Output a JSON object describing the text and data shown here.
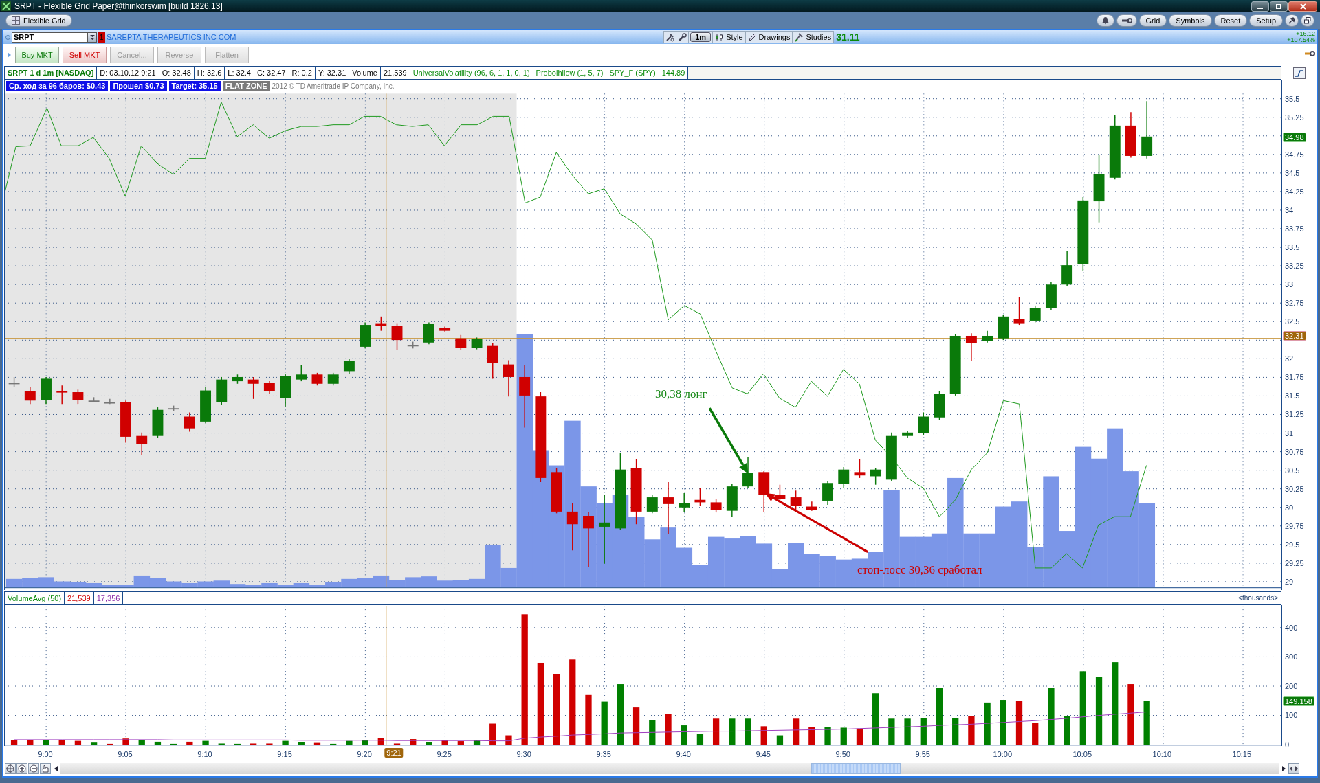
{
  "window": {
    "title": "SRPT - Flexible Grid Paper@thinkorswim [build 1826.13]"
  },
  "grid_bar": {
    "tab": "Flexible Grid",
    "buttons": [
      "Grid",
      "Symbols",
      "Reset",
      "Setup"
    ]
  },
  "symbol_bar": {
    "symbol": "SRPT",
    "link": "1",
    "company": "SAREPTA THERAPEUTICS INC COM",
    "aggregation": "1m",
    "tools": [
      "Style",
      "Drawings",
      "Studies"
    ],
    "last": "31.11",
    "change": "+16.12",
    "change_percent": "+107.54%"
  },
  "order_buttons": [
    {
      "label": "Buy MKT",
      "kind": "buy",
      "disabled": false
    },
    {
      "label": "Sell MKT",
      "kind": "sell",
      "disabled": false
    },
    {
      "label": "Cancel...",
      "disabled": true
    },
    {
      "label": "Reverse",
      "disabled": true
    },
    {
      "label": "Flatten",
      "disabled": true
    }
  ],
  "info_strip": [
    {
      "text": "SRPT 1 d 1m [NASDAQ]",
      "kind": "title"
    },
    {
      "text": "D: 03.10.12 9:21",
      "kind": "plain"
    },
    {
      "text": "O: 32.48",
      "kind": "plain"
    },
    {
      "text": "H: 32.6",
      "kind": "plain"
    },
    {
      "text": "L: 32.4",
      "kind": "plain"
    },
    {
      "text": "C: 32.47",
      "kind": "plain"
    },
    {
      "text": "R: 0.2",
      "kind": "plain"
    },
    {
      "text": "Y: 32.31",
      "kind": "plain"
    },
    {
      "text": "Volume",
      "kind": "plain"
    },
    {
      "text": "21,539",
      "kind": "plain"
    },
    {
      "text": "UniversalVolatility (96, 6, 1, 1, 0, 1)",
      "kind": "study"
    },
    {
      "text": "Proboihilow (1, 5, 7)",
      "kind": "study"
    },
    {
      "text": "SPY_F (SPY)",
      "kind": "study"
    },
    {
      "text": "144.89",
      "kind": "study"
    }
  ],
  "badges": [
    {
      "text": "Ср. ход за 96 баров: $0.43",
      "kind": "info"
    },
    {
      "text": "Прошел $0.73",
      "kind": "info"
    },
    {
      "text": "Target: 35.15",
      "kind": "info"
    },
    {
      "text": "FLAT ZONE",
      "kind": "zone"
    }
  ],
  "copyright": "2012 © TD Ameritrade IP Company, Inc.",
  "annotations": [
    {
      "text": "30,38 лонг",
      "kind": "long"
    },
    {
      "text": "стоп-лосс 30,36 сработал",
      "kind": "stop"
    }
  ],
  "price_axis": {
    "labels": [
      "35.5",
      "35.25",
      "34.75",
      "34.5",
      "34.25",
      "34",
      "33.75",
      "33.5",
      "33.25",
      "33",
      "32.75",
      "32.5",
      "32",
      "31.75",
      "31.5",
      "31.25",
      "31",
      "30.75",
      "30.5",
      "30.25",
      "30",
      "29.75",
      "29.5",
      "29.25",
      "29"
    ],
    "markers": [
      {
        "text": "34.98",
        "kind": "last"
      },
      {
        "text": "32.31",
        "kind": "cursor"
      }
    ]
  },
  "volume_header": {
    "volume": "21,539",
    "average": "17,356",
    "units": "<thousands>"
  },
  "volume_pane": {
    "marker": "149.158",
    "chart_data": {
      "type": "bar",
      "stacked": true,
      "grid": true,
      "categories": [
        null,
        null,
        "9:00",
        null,
        null,
        null,
        null,
        "9:05",
        null,
        null,
        null,
        null,
        "9:10",
        null,
        null,
        null,
        null,
        "9:15",
        null,
        null,
        null,
        null,
        "9:20",
        null,
        null,
        null,
        null,
        "9:25",
        null,
        null,
        null,
        null,
        "9:30",
        null,
        null,
        null,
        null,
        "9:35",
        null,
        null,
        null,
        null,
        "9:40",
        null,
        null,
        null,
        null,
        "9:45",
        null,
        null,
        null,
        null,
        "9:50",
        null,
        null,
        null,
        null,
        "9:55",
        null,
        null,
        null,
        null,
        "10:00",
        null,
        null,
        null,
        null,
        "10:05",
        null,
        null,
        null,
        null,
        "10:10",
        null,
        null,
        null,
        null,
        "10:15"
      ],
      "series": [
        {
          "color": "#008000",
          "values": [
            null,
            null,
            16,
            null,
            null,
            7,
            null,
            null,
            15,
            10,
            3,
            null,
            13,
            4,
            3,
            null,
            null,
            13,
            9,
            null,
            3,
            13,
            16,
            null,
            null,
            null,
            9,
            null,
            null,
            15,
            null,
            null,
            null,
            null,
            null,
            null,
            null,
            147,
            207,
            null,
            84,
            null,
            66,
            37,
            null,
            89,
            89,
            null,
            32,
            null,
            null,
            60,
            58,
            null,
            176,
            89,
            89,
            92,
            193,
            92,
            null,
            144,
            153,
            null,
            null,
            193,
            98,
            251,
            231,
            282,
            null,
            150,
            null,
            null,
            null,
            null,
            null,
            null
          ]
        },
        {
          "color": "#d00000",
          "values": [
            15,
            15,
            null,
            16,
            13,
            null,
            3,
            21,
            null,
            null,
            null,
            10,
            null,
            null,
            null,
            4,
            4,
            null,
            null,
            6,
            null,
            null,
            null,
            22,
            4,
            19,
            null,
            15,
            12,
            null,
            72,
            32,
            446,
            280,
            242,
            291,
            170,
            null,
            null,
            127,
            null,
            104,
            null,
            null,
            89,
            null,
            null,
            63,
            null,
            89,
            60,
            null,
            null,
            55,
            null,
            null,
            null,
            null,
            null,
            null,
            98,
            null,
            null,
            150,
            75,
            null,
            null,
            null,
            null,
            null,
            207,
            null,
            null,
            null,
            null,
            null,
            null,
            null
          ]
        },
        {
          "name": "VolumeAvg (50)",
          "color": "#a040c0",
          "type": "line",
          "values": [
            17,
            17,
            17,
            17,
            17,
            17,
            17,
            17,
            17,
            17,
            16,
            16,
            16,
            16,
            16,
            16,
            16,
            16,
            15,
            15,
            15,
            15,
            15,
            15,
            14,
            14,
            14,
            14,
            14,
            14,
            13,
            13,
            22,
            26,
            29,
            33,
            35,
            37,
            40,
            41,
            42,
            43,
            44,
            45,
            46,
            46,
            47,
            48,
            49,
            50,
            51,
            52,
            53,
            55,
            57,
            59,
            61,
            63,
            66,
            68,
            70,
            73,
            76,
            79,
            82,
            86,
            90,
            95,
            100,
            104,
            108,
            112,
            null,
            null,
            null,
            null,
            null,
            null
          ]
        }
      ],
      "ylim": [
        0,
        477
      ],
      "yticks": [
        0,
        100,
        200,
        300,
        400
      ]
    }
  },
  "time_axis": {
    "cursor": "9:21"
  }
}
